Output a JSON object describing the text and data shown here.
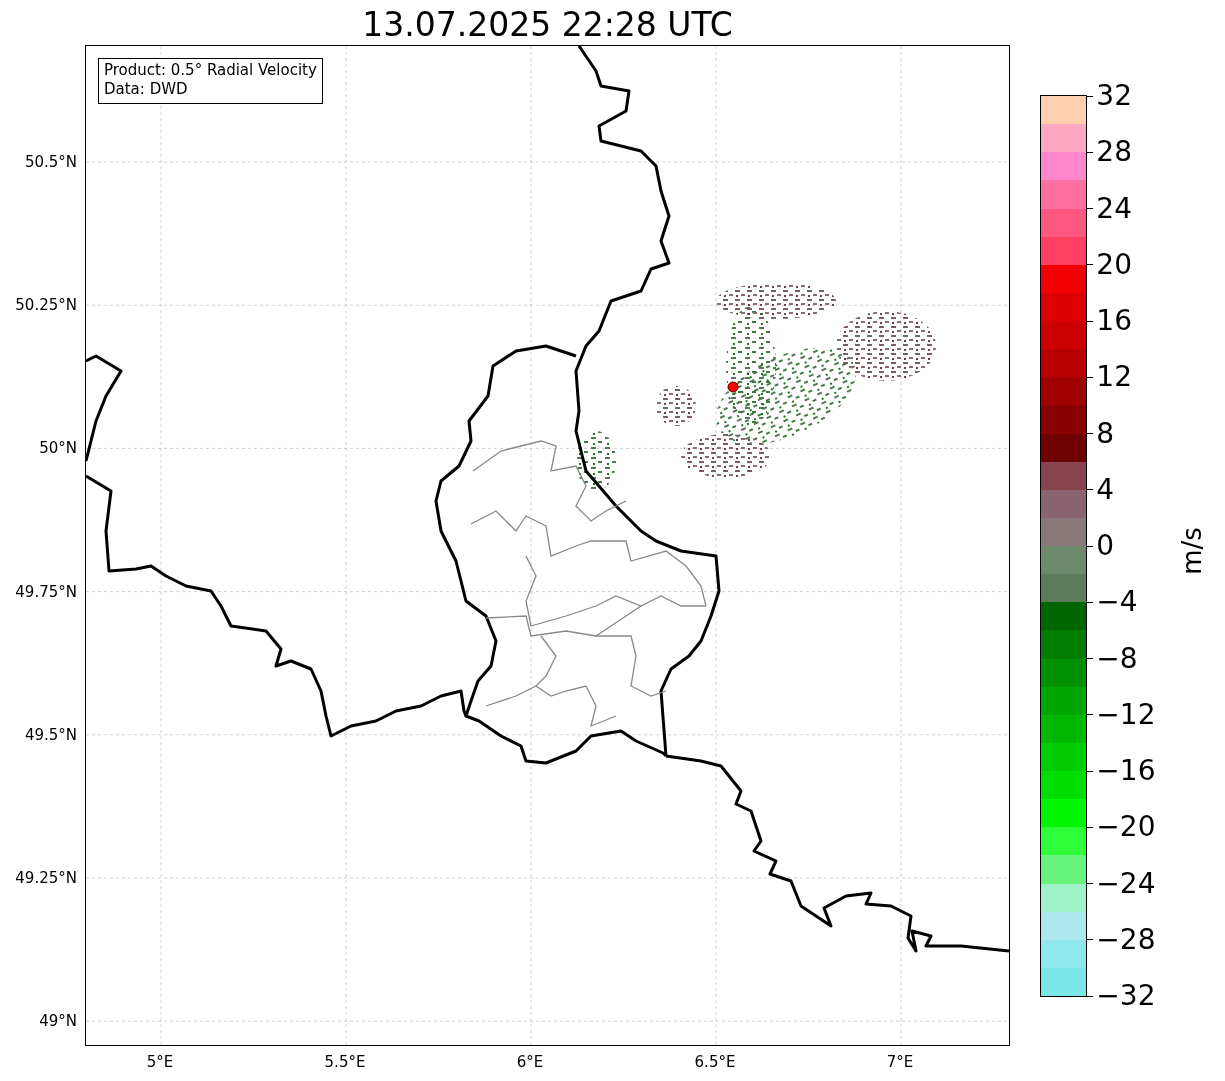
{
  "title": "13.07.2025 22:28 UTC",
  "map": {
    "legend": {
      "product": "Product: 0.5° Radial Velocity",
      "source": "Data: DWD"
    },
    "lat_ticks": [
      "50.5°N",
      "50.25°N",
      "50°N",
      "49.75°N",
      "49.5°N",
      "49.25°N",
      "49°N"
    ],
    "lon_ticks": [
      "5°E",
      "5.5°E",
      "6°E",
      "6.5°E",
      "7°E"
    ]
  },
  "colorbar": {
    "label": "m/s",
    "ticks": [
      "32",
      "28",
      "24",
      "20",
      "16",
      "12",
      "8",
      "4",
      "0",
      "−4",
      "−8",
      "−12",
      "−16",
      "−20",
      "−24",
      "−28",
      "−32"
    ],
    "bins": [
      {
        "color": "#ffd0b0"
      },
      {
        "color": "#ffa8c4"
      },
      {
        "color": "#ff88cc"
      },
      {
        "color": "#ff70a0"
      },
      {
        "color": "#ff5880"
      },
      {
        "color": "#ff4060"
      },
      {
        "color": "#f20000"
      },
      {
        "color": "#dc0000"
      },
      {
        "color": "#cc0000"
      },
      {
        "color": "#b80000"
      },
      {
        "color": "#a00000"
      },
      {
        "color": "#880000"
      },
      {
        "color": "#6e0000"
      },
      {
        "color": "#88444c"
      },
      {
        "color": "#8a6470"
      },
      {
        "color": "#8a7878"
      },
      {
        "color": "#6d8a6d"
      },
      {
        "color": "#5c7c5c"
      },
      {
        "color": "#006600"
      },
      {
        "color": "#007c00"
      },
      {
        "color": "#009000"
      },
      {
        "color": "#00a600"
      },
      {
        "color": "#00b800"
      },
      {
        "color": "#00cc00"
      },
      {
        "color": "#00de00"
      },
      {
        "color": "#00f600"
      },
      {
        "color": "#2eff3a"
      },
      {
        "color": "#66f47a"
      },
      {
        "color": "#9ef2c8"
      },
      {
        "color": "#aee8ee"
      },
      {
        "color": "#8ee8ec"
      },
      {
        "color": "#7ae6e8"
      }
    ]
  }
}
